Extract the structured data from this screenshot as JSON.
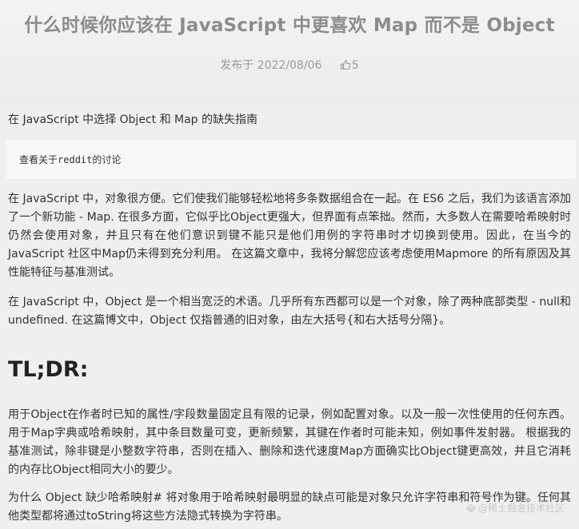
{
  "article": {
    "title": "什么时候你应该在 JavaScript 中更喜欢 Map 而不是 Object",
    "published": "发布于 2022/08/06",
    "likes": "5",
    "intro": "在 JavaScript 中选择 Object 和 Map 的缺失指南",
    "quote_prefix": "查看关于",
    "quote_code": "reddit",
    "quote_suffix": "的讨论",
    "paragraph1": "在 JavaScript 中，对象很方便。它们使我们能够轻松地将多条数据组合在一起。在 ES6 之后，我们为该语言添加了一个新功能 - Map. 在很多方面，它似乎比Object更强大，但界面有点笨拙。然而，大多数人在需要哈希映射时仍然会使用对象，并且只有在他们意识到键不能只是他们用例的字符串时才切换到使用。因此，在当今的 JavaScript 社区中Map仍未得到充分利用。 在这篇文章中，我将分解您应该考虑使用Mapmore 的所有原因及其性能特征与基准测试。",
    "paragraph2": "在 JavaScript 中，Object 是一个相当宽泛的术语。几乎所有东西都可以是一个对象，除了两种底部类型 - null和undefined. 在这篇博文中，Object 仅指普通的旧对象，由左大括号{和右大括号分隔}。",
    "heading": "TL;DR:",
    "paragraph3": "用于Object在作者时已知的属性/字段数量固定且有限的记录，例如配置对象。以及一般一次性使用的任何东西。 用于Map字典或哈希映射，其中条目数量可变，更新频繁，其键在作者时可能未知，例如事件发射器。 根据我的基准测试，除非键是小整数字符串，否则在插入、删除和迭代速度Map方面确实比Object键更高效，并且它消耗的内存比Object相同大小的要少。",
    "paragraph4": "为什么 Object 缺少哈希映射# 将对象用于哈希映射最明显的缺点可能是对象只允许字符串和符号作为键。任何其他类型都将通过toString将这些方法隐式转换为字符串。"
  },
  "watermark": "@稀土掘金技术社区",
  "icons": {
    "likes": "thumbs-up-icon",
    "watermark": "juejin-logo-icon"
  }
}
